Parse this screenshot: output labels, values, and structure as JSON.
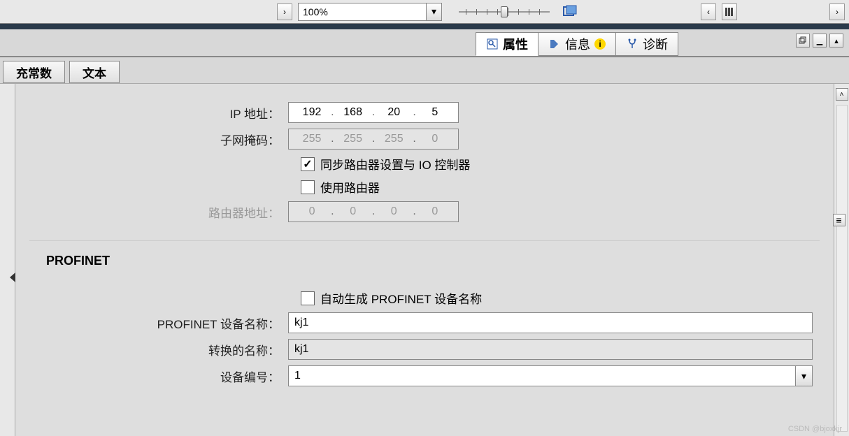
{
  "toolbar": {
    "zoom": "100%"
  },
  "inspector_tabs": {
    "properties": "属性",
    "info": "信息",
    "diagnostics": "诊断"
  },
  "subtabs": {
    "constants": "充常数",
    "text": "文本"
  },
  "network": {
    "ip_label": "IP 地址：",
    "ip": [
      "192",
      "168",
      "20",
      "5"
    ],
    "subnet_label": "子网掩码：",
    "subnet": [
      "255",
      "255",
      "255",
      "0"
    ],
    "sync_router_label": "同步路由器设置与 IO 控制器",
    "use_router_label": "使用路由器",
    "router_addr_label": "路由器地址：",
    "router_addr": [
      "0",
      "0",
      "0",
      "0"
    ]
  },
  "profinet": {
    "section_title": "PROFINET",
    "auto_name_label": "自动生成 PROFINET 设备名称",
    "device_name_label": "PROFINET 设备名称：",
    "device_name": "kj1",
    "converted_name_label": "转换的名称：",
    "converted_name": "kj1",
    "device_number_label": "设备编号：",
    "device_number": "1"
  },
  "watermark": "CSDN @bjoxkjr"
}
